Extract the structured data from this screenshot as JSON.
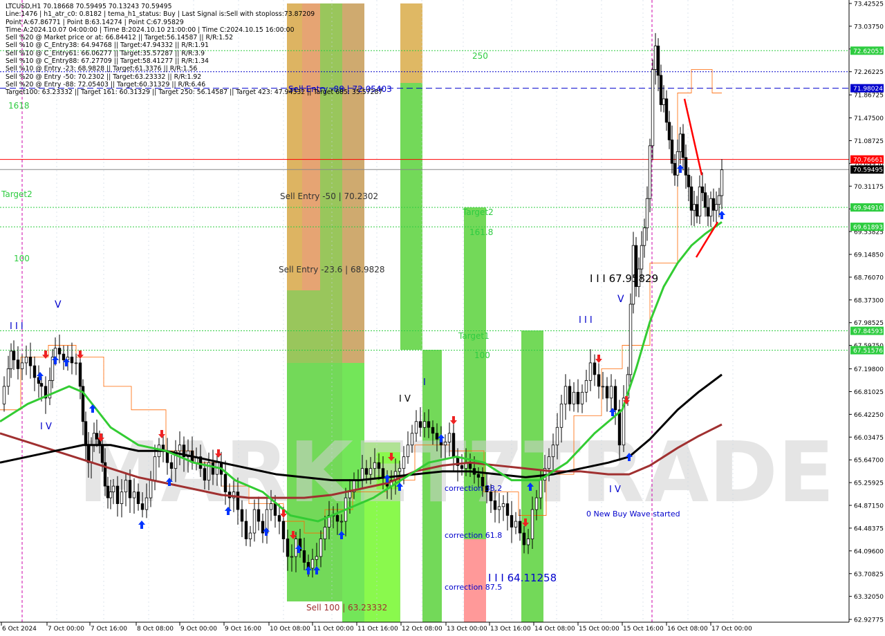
{
  "info_lines": [
    "LTCUSD,H1  70.18668 70.59495 70.13243 70.59495",
    "Line:1476 | h1_atr_c0: 0.8182 | tema_h1_status: Buy | Last Signal is:Sell with stoploss:73.87209",
    "Point A:67.86771 | Point B:63.14274 | Point C:67.95829",
    "Time A:2024.10.07 04:00:00 | Time B:2024.10.10 21:00:00 | Time C:2024.10.15 16:00:00",
    "Sell %20 @ Market price or at: 66.84412 || Target:56.14587 || R/R:1.52",
    "Sell %10 @ C_Entry38: 64.94768 || Target:47.94332 || R/R:1.91",
    "Sell %10 @ C_Entry61: 66.06277 || Target:35.57287 || R/R:3.9",
    "Sell %10 @ C_Entry88: 67.27709 || Target:58.41277 || R/R:1.34",
    "Sell %10 @ Entry -23: 68.9828 || Target:61.3376 || R/R:1.56",
    "Sell %20 @ Entry -50: 70.2302 || Target:63.23332 || R/R:1.92",
    "Sell %20 @ Entry -88: 72.05403 || Target:60.31329 || R/R:6.46",
    "Target100: 63.23332 || Target 161: 60.31329 || Target 250: 56.14587 || Target 423: 47.94332 || Target 685: 35.57287"
  ],
  "watermark": "MARKET7TRADE",
  "colors": {
    "green": "#2ecc40",
    "red": "#ff4444",
    "olive": "#b5a642",
    "brown": "#a03030",
    "black": "#000000",
    "blue": "#0000cc",
    "darkgreen": "#008000"
  },
  "chart_data": {
    "type": "candlestick",
    "symbol": "LTCUSD",
    "timeframe": "H1",
    "ylim": [
      62.92775,
      73.42525
    ],
    "y_ticks": [
      "73.42525",
      "73.03750",
      "72.64975",
      "72.26225",
      "71.86725",
      "71.47500",
      "71.08725",
      "70.69950",
      "70.31175",
      "69.92400",
      "69.53825",
      "69.14850",
      "68.76070",
      "68.37300",
      "67.98525",
      "67.59750",
      "67.19800",
      "66.81025",
      "66.42250",
      "66.03475",
      "65.64700",
      "65.25925",
      "64.87150",
      "64.48375",
      "64.09600",
      "63.70825",
      "63.32050",
      "62.92775"
    ],
    "x_ticks": [
      "6 Oct 2024",
      "7 Oct 00:00",
      "7 Oct 16:00",
      "8 Oct 08:00",
      "9 Oct 00:00",
      "9 Oct 16:00",
      "10 Oct 08:00",
      "11 Oct 00:00",
      "11 Oct 16:00",
      "12 Oct 08:00",
      "13 Oct 00:00",
      "13 Oct 16:00",
      "14 Oct 08:00",
      "15 Oct 00:00",
      "15 Oct 16:00",
      "16 Oct 08:00",
      "17 Oct 00:00"
    ],
    "price_labels": [
      {
        "text": "72.62053",
        "value": 72.62053,
        "color": "#2ecc40"
      },
      {
        "text": "71.98024",
        "value": 71.98024,
        "color": "#0000cc"
      },
      {
        "text": "70.76661",
        "value": 70.76661,
        "color": "#ff0000"
      },
      {
        "text": "70.59495",
        "value": 70.59495,
        "color": "#000000"
      },
      {
        "text": "69.94910",
        "value": 69.9491,
        "color": "#2ecc40"
      },
      {
        "text": "69.61893",
        "value": 69.61893,
        "color": "#2ecc40"
      },
      {
        "text": "67.84593",
        "value": 67.84593,
        "color": "#2ecc40"
      },
      {
        "text": "67.51576",
        "value": 67.51576,
        "color": "#2ecc40"
      }
    ],
    "hlines": [
      {
        "value": 72.62053,
        "style": "dotted",
        "color": "#2ecc40"
      },
      {
        "value": 72.26225,
        "style": "dotted",
        "color": "#0000cc"
      },
      {
        "value": 71.98024,
        "style": "dashed",
        "color": "#0000cc"
      },
      {
        "value": 70.76661,
        "style": "solid",
        "color": "#ff0000"
      },
      {
        "value": 70.59495,
        "style": "solid",
        "color": "#888888"
      },
      {
        "value": 69.9491,
        "style": "dotted",
        "color": "#2ecc40"
      },
      {
        "value": 69.61893,
        "style": "dotted",
        "color": "#2ecc40"
      },
      {
        "value": 67.84593,
        "style": "dotted",
        "color": "#2ecc40"
      },
      {
        "value": 67.51576,
        "style": "dotted",
        "color": "#2ecc40"
      }
    ],
    "annotations": [
      {
        "text": "250",
        "color": "#2ecc40"
      },
      {
        "text": "Sell Entry -88 | 72.05403",
        "color": "#0000cc"
      },
      {
        "text": "1618",
        "color": "#2ecc40"
      },
      {
        "text": "Target2",
        "color": "#2ecc40"
      },
      {
        "text": "Sell Entry -50 | 70.2302",
        "color": "#333333"
      },
      {
        "text": "Target2",
        "color": "#2ecc40"
      },
      {
        "text": "161.8",
        "color": "#2ecc40"
      },
      {
        "text": "100",
        "color": "#2ecc40"
      },
      {
        "text": "Sell Entry -23.6 | 68.9828",
        "color": "#333333"
      },
      {
        "text": "I I I 67.95829",
        "color": "#000000"
      },
      {
        "text": "Target1",
        "color": "#2ecc40"
      },
      {
        "text": "100",
        "color": "#2ecc40"
      },
      {
        "text": "correction 38.2",
        "color": "#0000cc"
      },
      {
        "text": "correction 61.8",
        "color": "#0000cc"
      },
      {
        "text": "correction 87.5",
        "color": "#0000cc"
      },
      {
        "text": "I I I 64.11258",
        "color": "#0000cc"
      },
      {
        "text": "Sell 100 | 63.23332",
        "color": "#a03030"
      },
      {
        "text": "0 New Buy Wave started",
        "color": "#0000cc"
      },
      {
        "text": "I I I",
        "color": "#0000cc"
      },
      {
        "text": "I I I",
        "color": "#0000cc"
      },
      {
        "text": "I V",
        "color": "#0000cc"
      },
      {
        "text": "V",
        "color": "#0000cc"
      },
      {
        "text": "I V",
        "color": "#000000"
      },
      {
        "text": "I V",
        "color": "#0000cc"
      },
      {
        "text": "V",
        "color": "#0000cc"
      },
      {
        "text": "I",
        "color": "#0000cc"
      }
    ],
    "close_path": [
      [
        0,
        66.6
      ],
      [
        6,
        66.9
      ],
      [
        12,
        67.2
      ],
      [
        16,
        67.5
      ],
      [
        20,
        67.35
      ],
      [
        26,
        67.2
      ],
      [
        32,
        67.3
      ],
      [
        38,
        67.4
      ],
      [
        44,
        67.25
      ],
      [
        50,
        67.05
      ],
      [
        56,
        66.95
      ],
      [
        60,
        66.9
      ],
      [
        66,
        66.7
      ],
      [
        72,
        67.0
      ],
      [
        76,
        67.4
      ],
      [
        80,
        67.55
      ],
      [
        86,
        67.45
      ],
      [
        92,
        67.35
      ],
      [
        98,
        67.4
      ],
      [
        104,
        67.3
      ],
      [
        110,
        67.3
      ],
      [
        116,
        66.9
      ],
      [
        120,
        66.3
      ],
      [
        124,
        65.9
      ],
      [
        128,
        65.6
      ],
      [
        132,
        65.9
      ],
      [
        136,
        66.1
      ],
      [
        140,
        66.0
      ],
      [
        144,
        65.9
      ],
      [
        148,
        65.6
      ],
      [
        152,
        65.2
      ],
      [
        156,
        65.0
      ],
      [
        160,
        65.1
      ],
      [
        164,
        65.2
      ],
      [
        170,
        64.9
      ],
      [
        176,
        65.1
      ],
      [
        182,
        65.3
      ],
      [
        188,
        65.0
      ],
      [
        194,
        65.1
      ],
      [
        200,
        64.9
      ],
      [
        206,
        64.8
      ],
      [
        212,
        65.0
      ],
      [
        218,
        65.3
      ],
      [
        224,
        65.7
      ],
      [
        230,
        65.9
      ],
      [
        236,
        65.8
      ],
      [
        242,
        65.6
      ],
      [
        248,
        65.5
      ],
      [
        254,
        65.8
      ],
      [
        260,
        65.9
      ],
      [
        266,
        65.7
      ],
      [
        272,
        65.8
      ],
      [
        278,
        65.6
      ],
      [
        284,
        65.7
      ],
      [
        290,
        65.5
      ],
      [
        296,
        65.3
      ],
      [
        302,
        65.6
      ],
      [
        308,
        65.4
      ],
      [
        314,
        65.6
      ],
      [
        320,
        65.4
      ],
      [
        326,
        65.1
      ],
      [
        332,
        65.0
      ],
      [
        338,
        65.1
      ],
      [
        344,
        64.8
      ],
      [
        350,
        64.6
      ],
      [
        356,
        64.3
      ],
      [
        362,
        64.4
      ],
      [
        368,
        64.8
      ],
      [
        374,
        64.6
      ],
      [
        380,
        64.4
      ],
      [
        386,
        64.8
      ],
      [
        392,
        64.9
      ],
      [
        398,
        64.7
      ],
      [
        404,
        64.6
      ],
      [
        410,
        64.3
      ],
      [
        416,
        64.0
      ],
      [
        422,
        64.0
      ],
      [
        428,
        64.3
      ],
      [
        434,
        64.1
      ],
      [
        440,
        63.9
      ],
      [
        446,
        63.8
      ],
      [
        452,
        63.95
      ],
      [
        458,
        64.0
      ],
      [
        464,
        64.3
      ],
      [
        470,
        64.5
      ],
      [
        476,
        64.7
      ],
      [
        482,
        64.7
      ],
      [
        488,
        64.6
      ],
      [
        494,
        64.6
      ],
      [
        500,
        65.0
      ],
      [
        506,
        65.1
      ],
      [
        512,
        65.3
      ],
      [
        518,
        65.3
      ],
      [
        524,
        65.5
      ],
      [
        530,
        65.4
      ],
      [
        536,
        65.5
      ],
      [
        542,
        65.6
      ],
      [
        548,
        65.5
      ],
      [
        554,
        65.35
      ],
      [
        560,
        65.2
      ],
      [
        566,
        65.3
      ],
      [
        572,
        65.45
      ],
      [
        578,
        65.5
      ],
      [
        584,
        65.7
      ],
      [
        590,
        65.9
      ],
      [
        596,
        66.1
      ],
      [
        602,
        66.3
      ],
      [
        608,
        66.2
      ],
      [
        614,
        66.3
      ],
      [
        620,
        66.2
      ],
      [
        626,
        66.1
      ],
      [
        632,
        66.0
      ],
      [
        638,
        65.9
      ],
      [
        644,
        65.95
      ],
      [
        650,
        66.1
      ],
      [
        656,
        65.7
      ],
      [
        662,
        65.55
      ],
      [
        668,
        65.5
      ],
      [
        674,
        65.6
      ],
      [
        680,
        65.5
      ],
      [
        686,
        65.4
      ],
      [
        692,
        65.35
      ],
      [
        698,
        65.2
      ],
      [
        704,
        65.1
      ],
      [
        710,
        64.95
      ],
      [
        716,
        64.8
      ],
      [
        722,
        64.85
      ],
      [
        728,
        64.9
      ],
      [
        734,
        64.7
      ],
      [
        740,
        64.5
      ],
      [
        746,
        64.6
      ],
      [
        752,
        64.4
      ],
      [
        758,
        64.2
      ],
      [
        764,
        64.3
      ],
      [
        770,
        64.8
      ],
      [
        776,
        65.0
      ],
      [
        782,
        65.3
      ],
      [
        788,
        65.5
      ],
      [
        794,
        65.7
      ],
      [
        800,
        65.9
      ],
      [
        806,
        66.2
      ],
      [
        812,
        66.6
      ],
      [
        818,
        66.9
      ],
      [
        824,
        66.6
      ],
      [
        830,
        66.8
      ],
      [
        836,
        66.6
      ],
      [
        842,
        66.8
      ],
      [
        848,
        67.0
      ],
      [
        854,
        67.3
      ],
      [
        860,
        67.1
      ],
      [
        866,
        66.9
      ],
      [
        872,
        66.9
      ],
      [
        878,
        66.7
      ],
      [
        884,
        66.9
      ],
      [
        890,
        66.5
      ],
      [
        896,
        65.9
      ],
      [
        902,
        66.7
      ],
      [
        908,
        67.1
      ],
      [
        912,
        68.3
      ],
      [
        916,
        69.3
      ],
      [
        920,
        68.6
      ],
      [
        924,
        68.9
      ],
      [
        928,
        69.3
      ],
      [
        932,
        69.6
      ],
      [
        936,
        70.1
      ],
      [
        940,
        71.0
      ],
      [
        944,
        72.3
      ],
      [
        948,
        72.7
      ],
      [
        952,
        72.2
      ],
      [
        956,
        71.7
      ],
      [
        960,
        71.8
      ],
      [
        964,
        71.4
      ],
      [
        968,
        71.1
      ],
      [
        972,
        70.7
      ],
      [
        976,
        70.5
      ],
      [
        980,
        70.9
      ],
      [
        984,
        71.2
      ],
      [
        988,
        70.8
      ],
      [
        992,
        70.5
      ],
      [
        996,
        70.3
      ],
      [
        1000,
        69.9
      ],
      [
        1004,
        70.0
      ],
      [
        1008,
        69.8
      ],
      [
        1012,
        70.3
      ],
      [
        1016,
        70.2
      ],
      [
        1020,
        69.95
      ],
      [
        1024,
        69.8
      ],
      [
        1028,
        70.1
      ],
      [
        1032,
        69.9
      ],
      [
        1036,
        70.0
      ],
      [
        1040,
        70.15
      ],
      [
        1044,
        70.59
      ]
    ],
    "ema_green": [
      [
        0,
        66.3
      ],
      [
        40,
        66.6
      ],
      [
        80,
        66.8
      ],
      [
        100,
        66.9
      ],
      [
        120,
        66.8
      ],
      [
        160,
        66.2
      ],
      [
        200,
        65.9
      ],
      [
        240,
        65.8
      ],
      [
        280,
        65.6
      ],
      [
        320,
        65.5
      ],
      [
        340,
        65.3
      ],
      [
        380,
        65.1
      ],
      [
        420,
        64.7
      ],
      [
        460,
        64.6
      ],
      [
        500,
        64.8
      ],
      [
        540,
        65.0
      ],
      [
        580,
        65.3
      ],
      [
        620,
        65.6
      ],
      [
        660,
        65.7
      ],
      [
        700,
        65.6
      ],
      [
        740,
        65.3
      ],
      [
        780,
        65.3
      ],
      [
        820,
        65.6
      ],
      [
        860,
        66.1
      ],
      [
        900,
        66.5
      ],
      [
        920,
        67.2
      ],
      [
        940,
        68.0
      ],
      [
        960,
        68.6
      ],
      [
        980,
        69.0
      ],
      [
        1000,
        69.3
      ],
      [
        1020,
        69.5
      ],
      [
        1044,
        69.7
      ]
    ],
    "ema_black": [
      [
        0,
        65.6
      ],
      [
        40,
        65.7
      ],
      [
        80,
        65.8
      ],
      [
        120,
        65.9
      ],
      [
        160,
        65.9
      ],
      [
        200,
        65.8
      ],
      [
        240,
        65.8
      ],
      [
        280,
        65.7
      ],
      [
        320,
        65.6
      ],
      [
        360,
        65.5
      ],
      [
        400,
        65.4
      ],
      [
        440,
        65.35
      ],
      [
        480,
        65.3
      ],
      [
        520,
        65.3
      ],
      [
        560,
        65.35
      ],
      [
        600,
        65.4
      ],
      [
        640,
        65.45
      ],
      [
        680,
        65.45
      ],
      [
        720,
        65.4
      ],
      [
        760,
        65.35
      ],
      [
        800,
        65.4
      ],
      [
        840,
        65.5
      ],
      [
        880,
        65.6
      ],
      [
        910,
        65.7
      ],
      [
        940,
        66.0
      ],
      [
        980,
        66.5
      ],
      [
        1010,
        66.8
      ],
      [
        1044,
        67.1
      ]
    ],
    "ema_brown": [
      [
        0,
        66.1
      ],
      [
        40,
        65.95
      ],
      [
        80,
        65.8
      ],
      [
        120,
        65.65
      ],
      [
        160,
        65.5
      ],
      [
        200,
        65.35
      ],
      [
        240,
        65.25
      ],
      [
        280,
        65.15
      ],
      [
        320,
        65.05
      ],
      [
        360,
        65.0
      ],
      [
        400,
        65.0
      ],
      [
        440,
        65.0
      ],
      [
        480,
        65.05
      ],
      [
        520,
        65.15
      ],
      [
        560,
        65.25
      ],
      [
        600,
        65.45
      ],
      [
        640,
        65.55
      ],
      [
        680,
        65.6
      ],
      [
        720,
        65.55
      ],
      [
        760,
        65.5
      ],
      [
        800,
        65.45
      ],
      [
        840,
        65.45
      ],
      [
        880,
        65.4
      ],
      [
        910,
        65.4
      ],
      [
        940,
        65.55
      ],
      [
        980,
        65.85
      ],
      [
        1010,
        66.05
      ],
      [
        1044,
        66.25
      ]
    ],
    "trend_lines": [
      {
        "points": [
          [
            990,
            71.8
          ],
          [
            1015,
            70.5
          ]
        ],
        "color": "#ff0000"
      },
      {
        "points": [
          [
            1007,
            69.1
          ],
          [
            1038,
            69.7
          ]
        ],
        "color": "#ff0000"
      }
    ]
  }
}
